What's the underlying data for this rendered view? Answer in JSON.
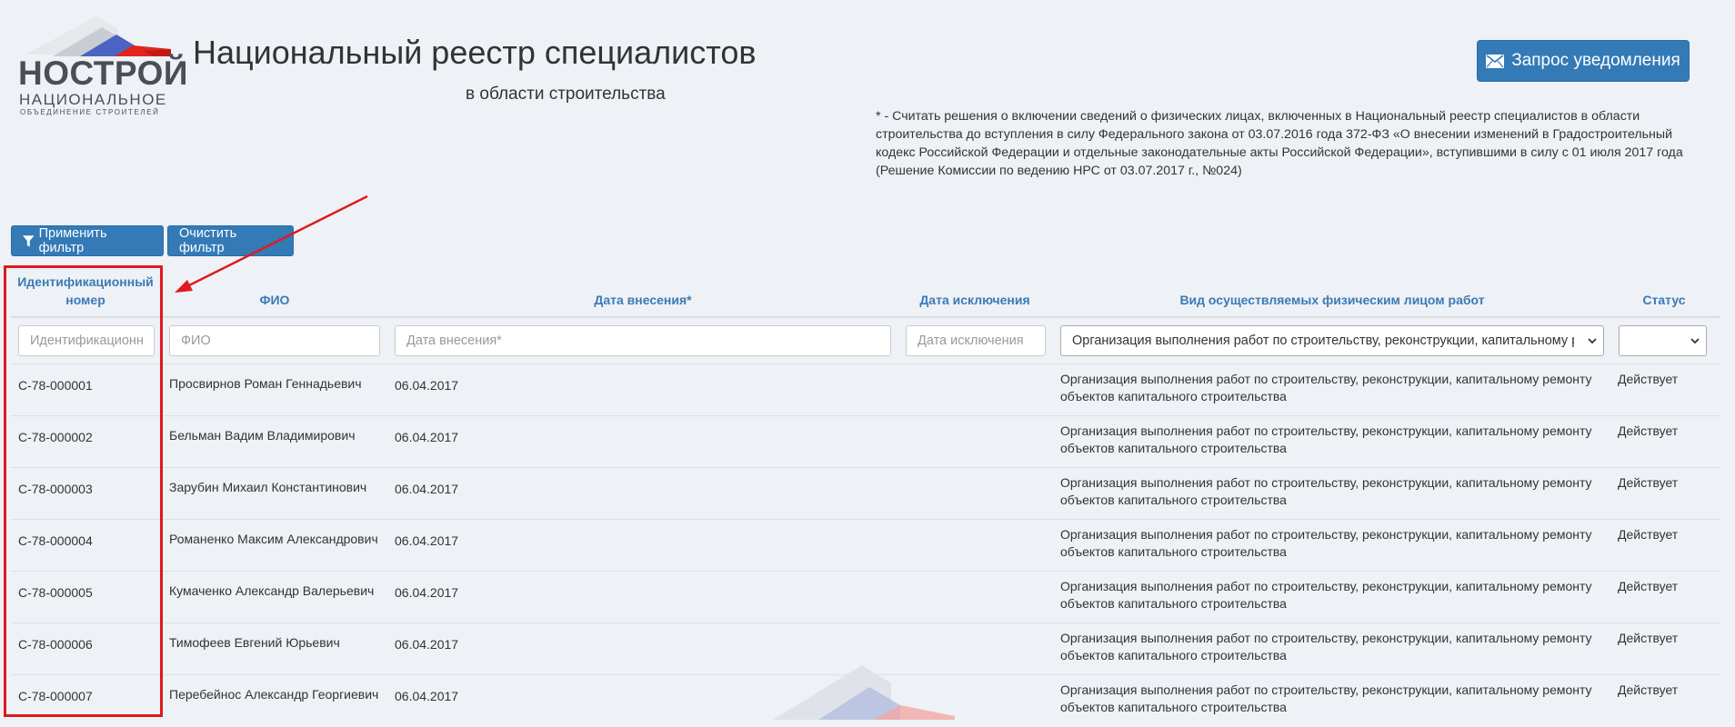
{
  "header": {
    "logo": {
      "main": "НОСТРОЙ",
      "sub": "НАЦИОНАЛЬНОЕ",
      "sub2": "ОБЪЕДИНЕНИЕ СТРОИТЕЛЕЙ"
    },
    "title": "Национальный реестр специалистов",
    "subtitle": "в области строительства",
    "notify_button": "Запрос уведомления",
    "note": "* - Считать решения о включении сведений о физических лицах, включенных в Национальный реестр специалистов в области строительства до вступления в силу Федерального закона от 03.07.2016 года 372-ФЗ «О внесении изменений в Градостроительный кодекс Российской Федерации и отдельные законодательные акты Российской Федерации», вступившими в силу с 01 июля 2017 года (Решение Комиссии по ведению НРС от 03.07.2017 г., №024)"
  },
  "toolbar": {
    "apply_label": "Применить фильтр",
    "clear_label": "Очистить фильтр"
  },
  "table": {
    "columns": {
      "id": "Идентификационный номер",
      "fio": "ФИО",
      "date_in": "Дата внесения*",
      "date_out": "Дата исключения",
      "work": "Вид осуществляемых физическим лицом работ",
      "status": "Статус"
    },
    "filters": {
      "id_placeholder": "Идентификационный номер",
      "fio_placeholder": "ФИО",
      "date_in_placeholder": "Дата внесения*",
      "date_out_placeholder": "Дата исключения",
      "work_selected": "Организация выполнения работ по строительству, реконструкции, капитальному ремонту объектов капитального строительства",
      "status_selected": ""
    },
    "rows": [
      {
        "id": "С-78-000001",
        "fio": "Просвирнов Роман Геннадьевич",
        "date_in": "06.04.2017",
        "date_out": "",
        "work": "Организация выполнения работ по строительству, реконструкции, капитальному ремонту объектов капитального строительства",
        "status": "Действует"
      },
      {
        "id": "С-78-000002",
        "fio": "Бельман Вадим Владимирович",
        "date_in": "06.04.2017",
        "date_out": "",
        "work": "Организация выполнения работ по строительству, реконструкции, капитальному ремонту объектов капитального строительства",
        "status": "Действует"
      },
      {
        "id": "С-78-000003",
        "fio": "Зарубин Михаил Константинович",
        "date_in": "06.04.2017",
        "date_out": "",
        "work": "Организация выполнения работ по строительству, реконструкции, капитальному ремонту объектов капитального строительства",
        "status": "Действует"
      },
      {
        "id": "С-78-000004",
        "fio": "Романенко Максим Александрович",
        "date_in": "06.04.2017",
        "date_out": "",
        "work": "Организация выполнения работ по строительству, реконструкции, капитальному ремонту объектов капитального строительства",
        "status": "Действует"
      },
      {
        "id": "С-78-000005",
        "fio": "Кумаченко Александр Валерьевич",
        "date_in": "06.04.2017",
        "date_out": "",
        "work": "Организация выполнения работ по строительству, реконструкции, капитальному ремонту объектов капитального строительства",
        "status": "Действует"
      },
      {
        "id": "С-78-000006",
        "fio": "Тимофеев Евгений Юрьевич",
        "date_in": "06.04.2017",
        "date_out": "",
        "work": "Организация выполнения работ по строительству, реконструкции, капитальному ремонту объектов капитального строительства",
        "status": "Действует"
      },
      {
        "id": "С-78-000007",
        "fio": "Перебейнос Александр Георгиевич",
        "date_in": "06.04.2017",
        "date_out": "",
        "work": "Организация выполнения работ по строительству, реконструкции, капитальному ремонту объектов капитального строительства",
        "status": "Действует"
      }
    ]
  },
  "colors": {
    "accent": "#337ab7",
    "header_text": "#3a7ab8",
    "annotation": "#e0191e",
    "background": "#eef1f5"
  }
}
